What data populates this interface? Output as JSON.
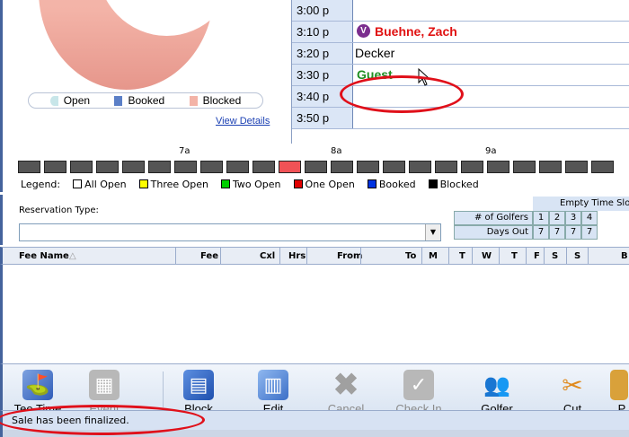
{
  "colors": {
    "accent": "#44639c",
    "guest": "#1f8f22",
    "member": "#e01212",
    "annotation": "#e0101a"
  },
  "legend_pill": {
    "open": "Open",
    "booked": "Booked",
    "blocked": "Blocked"
  },
  "view_details": "View Details",
  "slots": [
    {
      "time": "3:00 p",
      "name": ""
    },
    {
      "time": "3:10 p",
      "name": "Buehne, Zach",
      "badge": "V"
    },
    {
      "time": "3:20 p",
      "name": "Decker"
    },
    {
      "time": "3:30 p",
      "name": "Guest"
    },
    {
      "time": "3:40 p",
      "name": ""
    },
    {
      "time": "3:50 p",
      "name": ""
    }
  ],
  "ruler": {
    "labels": [
      "7a",
      "8a",
      "9a"
    ]
  },
  "legend": {
    "title": "Legend:",
    "items": [
      "All Open",
      "Three Open",
      "Two Open",
      "One Open",
      "Booked",
      "Blocked"
    ]
  },
  "reservation": {
    "label": "Reservation Type:",
    "value": ""
  },
  "golfer_grid": {
    "header": "Empty Time Slo",
    "row1_label": "# of Golfers",
    "row1": [
      "1",
      "2",
      "3",
      "4"
    ],
    "row2_label": "Days Out",
    "row2": [
      "7",
      "7",
      "7",
      "7"
    ]
  },
  "fee_columns": [
    "Fee Name",
    "Fee",
    "Cxl",
    "Hrs",
    "From",
    "To",
    "M",
    "T",
    "W",
    "T",
    "F",
    "S",
    "S",
    "B"
  ],
  "toolbar": {
    "tee_time": "Tee Time",
    "event": "Event",
    "block": "Block",
    "edit": "Edit",
    "cancel": "Cancel",
    "check_in": "Check In",
    "golfer": "Golfer",
    "cut": "Cut",
    "paste": "P"
  },
  "status": "Sale has been finalized."
}
